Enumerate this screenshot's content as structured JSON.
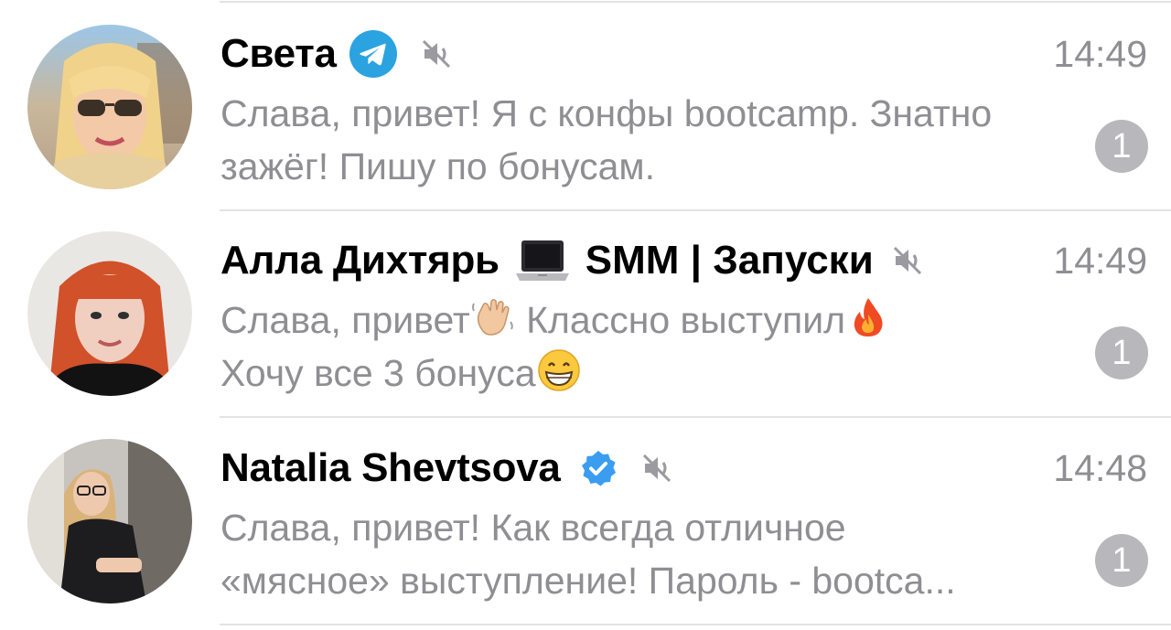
{
  "chats": [
    {
      "name": "Света",
      "time": "14:49",
      "unread": "1",
      "preview_line1": "Слава, привет! Я с конфы bootcamp. Знатно",
      "preview_line2": "зажёг! Пишу по бонусам.",
      "badge_icon": "telegram-icon",
      "muted": true
    },
    {
      "name": "Алла Дихтярь",
      "name_suffix": "SMM | Запуски",
      "time": "14:49",
      "unread": "1",
      "preview_line1_a": "Слава, привет",
      "preview_line1_b": " Классно выступил",
      "preview_line2": "Хочу все 3 бонуса",
      "badge_icon": "laptop-emoji",
      "emojis": [
        "waving-hand-emoji",
        "fire-emoji",
        "grinning-face-emoji"
      ],
      "muted": true
    },
    {
      "name": "Natalia Shevtsova",
      "time": "14:48",
      "unread": "1",
      "preview_line1": "Слава, привет! Как всегда отличное",
      "preview_line2": "«мясное» выступление! Пароль - bootca...",
      "badge_icon": "verified-icon",
      "muted": true
    }
  ],
  "colors": {
    "name": "#000000",
    "secondary": "#8e8e93",
    "unread_badge": "#b8b8bc",
    "telegram_blue": "#2aa3e0",
    "verified_blue": "#3a9df0",
    "separator": "#e3e3e6"
  }
}
